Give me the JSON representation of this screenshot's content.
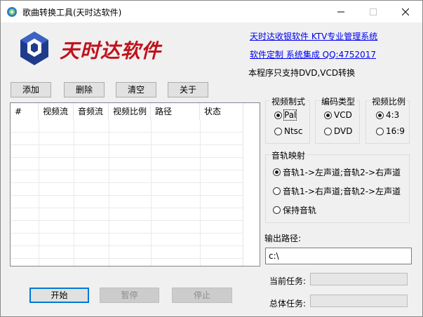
{
  "window": {
    "title": "歌曲转换工具(天时达软件)"
  },
  "brand": {
    "logo_text": "天时达软件"
  },
  "links": {
    "ktv_system": "天时达收银软件 KTV专业管理系统",
    "custom_dev": "软件定制 系统集成 QQ:4752017"
  },
  "note": "本程序只支持DVD,VCD转换",
  "toolbar": {
    "add": "添加",
    "delete": "删除",
    "clear": "清空",
    "about": "关于"
  },
  "list": {
    "columns": [
      "#",
      "视频流",
      "音频流",
      "视频比例",
      "路径",
      "状态"
    ],
    "rows": []
  },
  "video_format": {
    "title": "视频制式",
    "options": [
      "Pal",
      "Ntsc"
    ],
    "selected": "Pal"
  },
  "encode_type": {
    "title": "编码类型",
    "options": [
      "VCD",
      "DVD"
    ],
    "selected": "VCD"
  },
  "aspect_ratio": {
    "title": "视频比例",
    "options": [
      "4:3",
      "16:9"
    ],
    "selected": "4:3"
  },
  "audio_map": {
    "title": "音轨映射",
    "options": [
      "音轨1->左声道;音轨2->右声道",
      "音轨1->右声道;音轨2->左声道",
      "保持音轨"
    ],
    "selected": "音轨1->左声道;音轨2->右声道"
  },
  "output": {
    "label": "输出路径:",
    "value": "c:\\"
  },
  "progress": {
    "current_label": "当前任务:",
    "total_label": "总体任务:",
    "current_value": 0,
    "total_value": 0
  },
  "actions": {
    "start": "开始",
    "pause": "暂停",
    "stop": "停止"
  },
  "colors": {
    "link": "#0000ee",
    "logo_red": "#c0121b",
    "logo_blue": "#1f3b8c",
    "accent": "#0078d7"
  }
}
